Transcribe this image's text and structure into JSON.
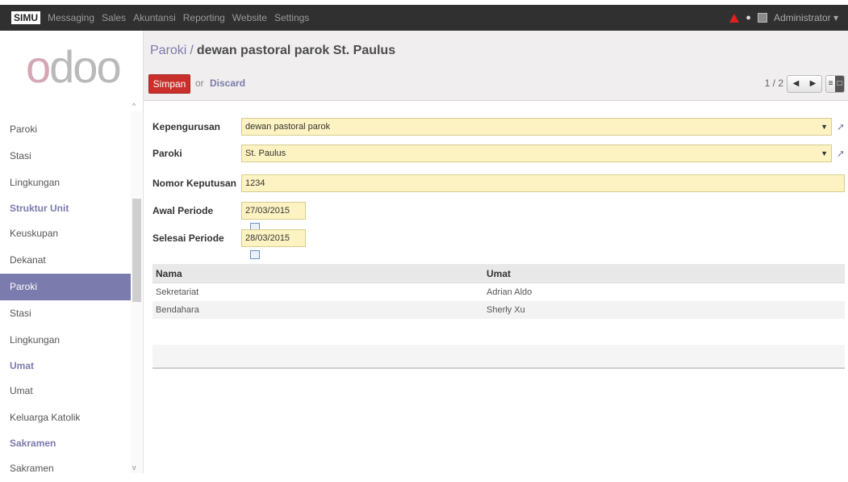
{
  "topbar": {
    "brand": "SIMU",
    "menu": [
      "Messaging",
      "Sales",
      "Akuntansi",
      "Reporting",
      "Website",
      "Settings"
    ],
    "user": "Administrator ▾"
  },
  "sidebar": {
    "logo": "odoo",
    "items": [
      {
        "label": "Paroki",
        "type": "item"
      },
      {
        "label": "Stasi",
        "type": "item"
      },
      {
        "label": "Lingkungan",
        "type": "item"
      },
      {
        "label": "Struktur Unit",
        "type": "header"
      },
      {
        "label": "Keuskupan",
        "type": "item"
      },
      {
        "label": "Dekanat",
        "type": "item"
      },
      {
        "label": "Paroki",
        "type": "active"
      },
      {
        "label": "Stasi",
        "type": "item"
      },
      {
        "label": "Lingkungan",
        "type": "item"
      },
      {
        "label": "Umat",
        "type": "header"
      },
      {
        "label": "Umat",
        "type": "item"
      },
      {
        "label": "Keluarga Katolik",
        "type": "item"
      },
      {
        "label": "Sakramen",
        "type": "header"
      },
      {
        "label": "Sakramen",
        "type": "item"
      }
    ]
  },
  "header": {
    "breadcrumb_link": "Paroki",
    "breadcrumb_sep": "/",
    "breadcrumb_current": "dewan pastoral parok St. Paulus",
    "save_label": "Simpan",
    "or_text": "or",
    "discard_label": "Discard",
    "pager": "1 / 2"
  },
  "form": {
    "kepengurusan": {
      "label": "Kepengurusan",
      "value": "dewan pastoral parok"
    },
    "paroki": {
      "label": "Paroki",
      "value": "St. Paulus"
    },
    "nomor": {
      "label": "Nomor Keputusan",
      "value": "1234"
    },
    "awal": {
      "label": "Awal Periode",
      "value": "27/03/2015"
    },
    "selesai": {
      "label": "Selesai Periode",
      "value": "28/03/2015"
    }
  },
  "table": {
    "headers": [
      "Nama",
      "Umat"
    ],
    "rows": [
      [
        "Sekretariat",
        "Adrian Aldo"
      ],
      [
        "Bendahara",
        "Sherly Xu"
      ]
    ]
  },
  "colors": {
    "accent": "#7c7bad",
    "save": "#c9302c",
    "field_bg": "#fdf3c2"
  }
}
